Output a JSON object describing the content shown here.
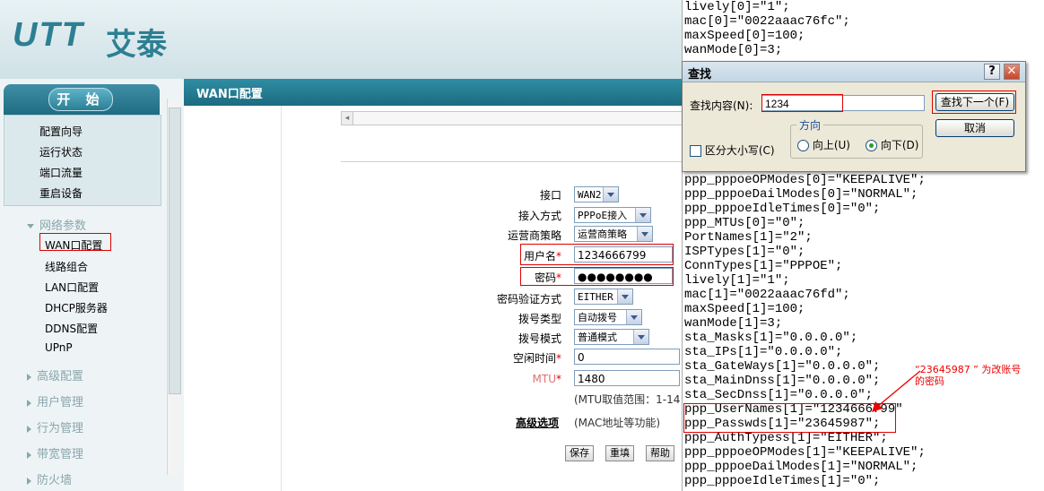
{
  "header": {
    "logo_text": "UTT",
    "brand": "艾泰"
  },
  "sidebar": {
    "start_label": "开 始",
    "top_items": [
      "配置向导",
      "运行状态",
      "端口流量",
      "重启设备"
    ],
    "open_section": "网络参数",
    "sub_items": [
      "WAN口配置",
      "线路组合",
      "LAN口配置",
      "DHCP服务器",
      "DDNS配置",
      "UPnP"
    ],
    "collapsed_sections": [
      "高级配置",
      "用户管理",
      "行为管理",
      "带宽管理",
      "防火墙"
    ]
  },
  "page": {
    "title": "WAN口配置"
  },
  "form": {
    "port_label": "接口",
    "port_value": "WAN2",
    "access_label": "接入方式",
    "access_value": "PPPoE接入",
    "isp_label": "运营商策略",
    "isp_value": "运营商策略",
    "user_label": "用户名",
    "user_value": "1234666799",
    "pass_label": "密码",
    "pass_value": "●●●●●●●●",
    "auth_label": "密码验证方式",
    "auth_value": "EITHER",
    "dial_type_label": "拨号类型",
    "dial_type_value": "自动拨号",
    "dial_mode_label": "拨号模式",
    "dial_mode_value": "普通模式",
    "idle_label": "空闲时间",
    "idle_value": "0",
    "mtu_label": "MTU",
    "mtu_value": "1480",
    "mtu_note": "(MTU取值范围：1-14",
    "advanced_label": "高级选项",
    "advanced_note": "(MAC地址等功能)",
    "save_label": "保存",
    "reset_label": "重填",
    "help_label": "帮助"
  },
  "code_lines": [
    "lively[0]=\"1\";",
    "mac[0]=\"0022aaac76fc\";",
    "maxSpeed[0]=100;",
    "wanMode[0]=3;",
    "ppp_pppoeOPModes[0]=\"KEEPALIVE\";",
    "ppp_pppoeDailModes[0]=\"NORMAL\";",
    "ppp_pppoeIdleTimes[0]=\"0\";",
    "ppp_MTUs[0]=\"0\";",
    "PortNames[1]=\"2\";",
    "ISPTypes[1]=\"0\";",
    "ConnTypes[1]=\"PPPOE\";",
    "lively[1]=\"1\";",
    "mac[1]=\"0022aaac76fd\";",
    "maxSpeed[1]=100;",
    "wanMode[1]=3;",
    "sta_Masks[1]=\"0.0.0.0\";",
    "sta_IPs[1]=\"0.0.0.0\";",
    "sta_GateWays[1]=\"0.0.0.0\";",
    "sta_MainDnss[1]=\"0.0.0.0\";",
    "sta_SecDnss[1]=\"0.0.0.0\";",
    "ppp_UserNames[1]=\"1234666799\"",
    "ppp_Passwds[1]=\"23645987\";",
    "ppp_AuthTypess[1]=\"EITHER\";",
    "ppp_pppoeOPModes[1]=\"KEEPALIVE\";",
    "ppp_pppoeDailModes[1]=\"NORMAL\";",
    "ppp_pppoeIdleTimes[1]=\"0\";"
  ],
  "find_dialog": {
    "title": "查找",
    "help_btn": "?",
    "close_btn": "✕",
    "find_label": "查找内容(N):",
    "find_value": "1234",
    "find_next": "查找下一个(F)",
    "cancel": "取消",
    "direction_label": "方向",
    "up_label": "向上(U)",
    "down_label": "向下(D)",
    "match_case": "区分大小写(C)"
  },
  "annotation": {
    "line1": "“23645987 ” 为改账号",
    "line2": "的密码"
  }
}
